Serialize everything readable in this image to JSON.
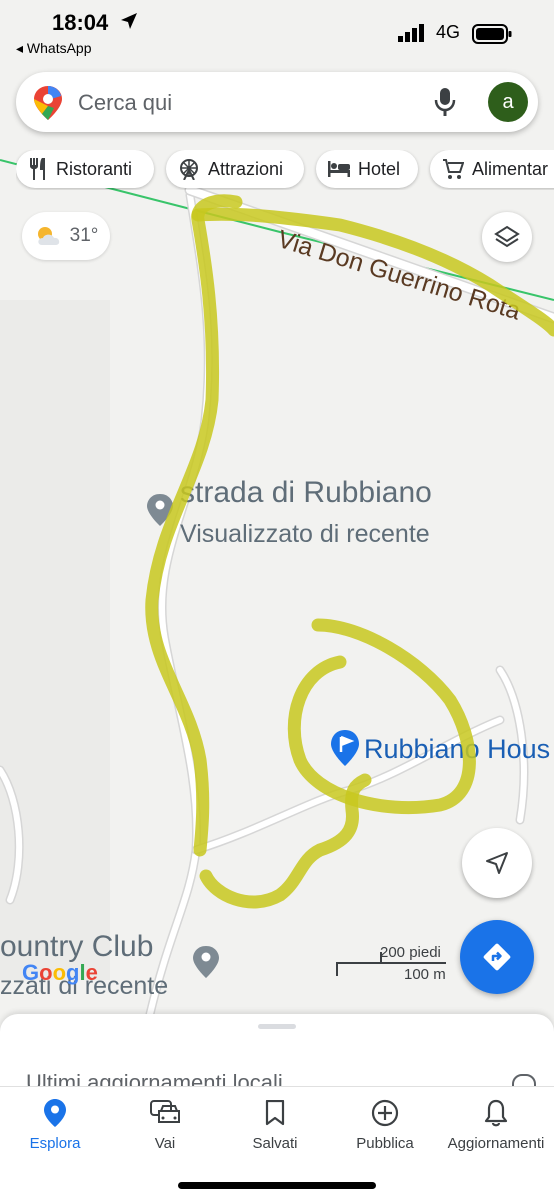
{
  "status_bar": {
    "time": "18:04",
    "back_app": "◂ WhatsApp",
    "network": "4G"
  },
  "search": {
    "placeholder": "Cerca qui",
    "avatar_letter": "a"
  },
  "chips": [
    {
      "label": "Ristoranti",
      "icon": "restaurant-icon"
    },
    {
      "label": "Attrazioni",
      "icon": "attraction-icon"
    },
    {
      "label": "Hotel",
      "icon": "hotel-icon"
    },
    {
      "label": "Alimentar",
      "icon": "cart-icon"
    }
  ],
  "weather": {
    "temp": "31°",
    "icon": "partly-cloudy-icon"
  },
  "map": {
    "road_label": "Via Don Guerrino Rota",
    "place1": {
      "name": "strada di Rubbiano",
      "sub": "Visualizzato di recente"
    },
    "place2": {
      "name": "Rubbiano Hous"
    },
    "place3": {
      "name": "ountry Club",
      "sub": "zzati di recente"
    },
    "google_logo": "Google",
    "scale_top": "200 piedi",
    "scale_bottom": "100 m",
    "highlight_color": "#c8c81e"
  },
  "sheet": {
    "peek_text": "Ultimi aggiornamenti locali"
  },
  "nav": [
    {
      "label": "Esplora",
      "icon": "pin-icon",
      "active": true
    },
    {
      "label": "Vai",
      "icon": "car-icon",
      "active": false
    },
    {
      "label": "Salvati",
      "icon": "bookmark-icon",
      "active": false
    },
    {
      "label": "Pubblica",
      "icon": "plus-circle-icon",
      "active": false
    },
    {
      "label": "Aggiornamenti",
      "icon": "bell-icon",
      "active": false
    }
  ],
  "colors": {
    "accent": "#1a73e8",
    "avatar": "#2e5e1b"
  }
}
